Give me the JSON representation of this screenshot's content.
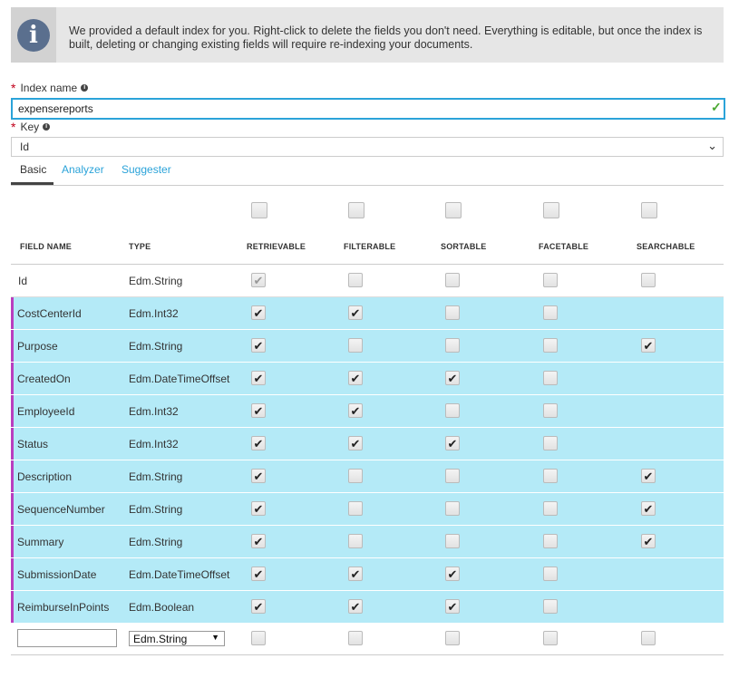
{
  "banner": {
    "icon": "info-icon",
    "text": "We provided a default index for you. Right-click to delete the fields you don't need. Everything is editable, but once the index is built, deleting or changing existing fields will require re-indexing your documents."
  },
  "index_name": {
    "label": "Index name",
    "value": "expensereports"
  },
  "key": {
    "label": "Key",
    "value": "Id"
  },
  "tabs": [
    {
      "label": "Basic",
      "active": true
    },
    {
      "label": "Analyzer",
      "active": false
    },
    {
      "label": "Suggester",
      "active": false
    }
  ],
  "columns": [
    "FIELD NAME",
    "TYPE",
    "RETRIEVABLE",
    "FILTERABLE",
    "SORTABLE",
    "FACETABLE",
    "SEARCHABLE"
  ],
  "header_checkboxes": [
    false,
    false,
    false,
    false,
    false
  ],
  "rows": [
    {
      "name": "Id",
      "type": "Edm.String",
      "selected": false,
      "flags": [
        "dim-checked",
        "unchecked",
        "unchecked",
        "unchecked",
        "unchecked"
      ]
    },
    {
      "name": "CostCenterId",
      "type": "Edm.Int32",
      "selected": true,
      "flags": [
        "checked",
        "checked",
        "unchecked",
        "unchecked",
        "none"
      ]
    },
    {
      "name": "Purpose",
      "type": "Edm.String",
      "selected": true,
      "flags": [
        "checked",
        "unchecked",
        "unchecked",
        "unchecked",
        "checked"
      ]
    },
    {
      "name": "CreatedOn",
      "type": "Edm.DateTimeOffset",
      "selected": true,
      "flags": [
        "checked",
        "checked",
        "checked",
        "unchecked",
        "none"
      ]
    },
    {
      "name": "EmployeeId",
      "type": "Edm.Int32",
      "selected": true,
      "flags": [
        "checked",
        "checked",
        "unchecked",
        "unchecked",
        "none"
      ]
    },
    {
      "name": "Status",
      "type": "Edm.Int32",
      "selected": true,
      "flags": [
        "checked",
        "checked",
        "checked",
        "unchecked",
        "none"
      ]
    },
    {
      "name": "Description",
      "type": "Edm.String",
      "selected": true,
      "flags": [
        "checked",
        "unchecked",
        "unchecked",
        "unchecked",
        "checked"
      ]
    },
    {
      "name": "SequenceNumber",
      "type": "Edm.String",
      "selected": true,
      "flags": [
        "checked",
        "unchecked",
        "unchecked",
        "unchecked",
        "checked"
      ]
    },
    {
      "name": "Summary",
      "type": "Edm.String",
      "selected": true,
      "flags": [
        "checked",
        "unchecked",
        "unchecked",
        "unchecked",
        "checked"
      ]
    },
    {
      "name": "SubmissionDate",
      "type": "Edm.DateTimeOffset",
      "selected": true,
      "flags": [
        "checked",
        "checked",
        "checked",
        "unchecked",
        "none"
      ]
    },
    {
      "name": "ReimburseInPoints",
      "type": "Edm.Boolean",
      "selected": true,
      "flags": [
        "checked",
        "checked",
        "checked",
        "unchecked",
        "none"
      ]
    }
  ],
  "new_field": {
    "name_value": "",
    "type_value": "Edm.String",
    "flags": [
      "unchecked",
      "unchecked",
      "unchecked",
      "unchecked",
      "unchecked"
    ]
  },
  "colors": {
    "selected_row": "#b4eaf7",
    "row_marker": "#b93ebf",
    "accent": "#2ba3d9",
    "required": "#c0001a",
    "valid": "#4aa832"
  }
}
